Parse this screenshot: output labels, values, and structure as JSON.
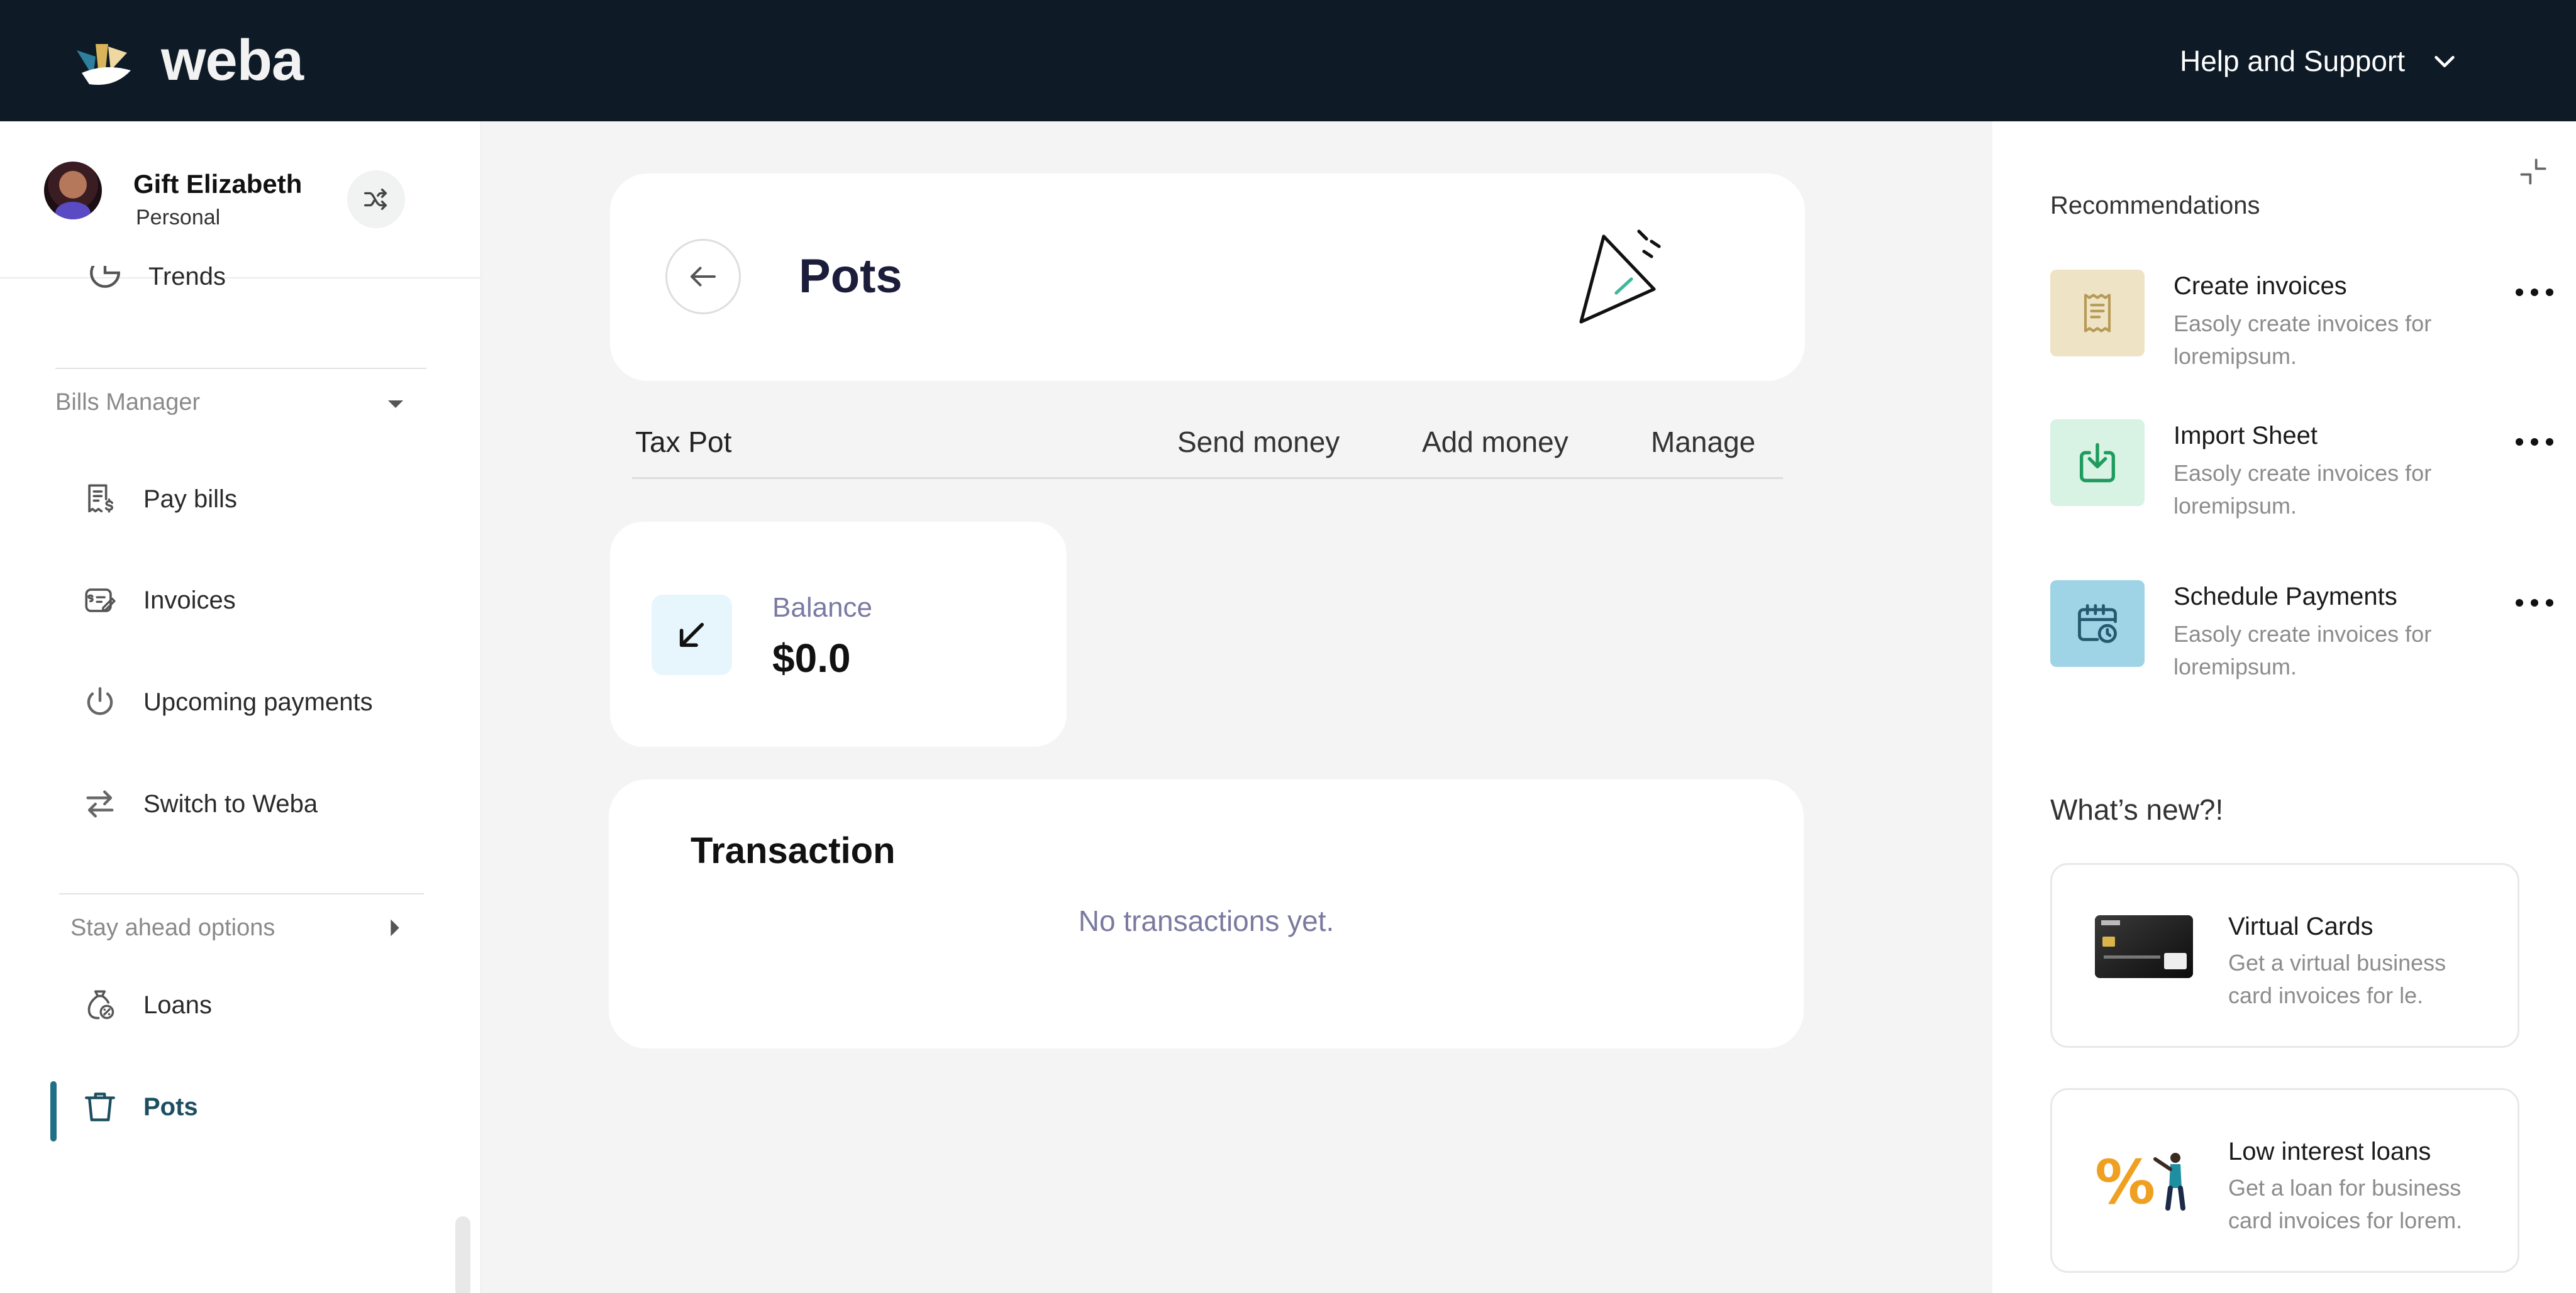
{
  "header": {
    "logo_text": "weba",
    "help_label": "Help and Support"
  },
  "user": {
    "name": "Gift Elizabeth",
    "account_type": "Personal"
  },
  "sidebar": {
    "partial_item": "Trends",
    "sections": [
      {
        "title": "Bills Manager",
        "expanded": true,
        "items": [
          {
            "label": "Pay bills",
            "icon": "receipt-dollar-icon"
          },
          {
            "label": "Invoices",
            "icon": "invoice-edit-icon"
          },
          {
            "label": "Upcoming payments",
            "icon": "power-icon"
          },
          {
            "label": "Switch to Weba",
            "icon": "arrows-swap-icon"
          }
        ]
      },
      {
        "title": "Stay ahead options",
        "expanded": false,
        "items": [
          {
            "label": "Loans",
            "icon": "money-bag-icon"
          },
          {
            "label": "Pots",
            "icon": "pot-icon",
            "active": true
          }
        ]
      }
    ]
  },
  "main": {
    "page_title": "Pots",
    "pot_name": "Tax Pot",
    "actions": [
      "Send money",
      "Add money",
      "Manage"
    ],
    "balance": {
      "label": "Balance",
      "value": "$0.0"
    },
    "transactions": {
      "title": "Transaction",
      "empty_text": "No transactions yet."
    }
  },
  "right_panel": {
    "recommendations_title": "Recommendations",
    "recommendations": [
      {
        "title": "Create invoices",
        "desc": "Easoly create invoices for loremipsum.",
        "icon": "receipt-icon",
        "bg": "#efe3c6"
      },
      {
        "title": "Import Sheet",
        "desc": "Easoly create invoices for loremipsum.",
        "icon": "download-icon",
        "bg": "#d8f2e4"
      },
      {
        "title": "Schedule Payments",
        "desc": "Easoly create invoices for loremipsum.",
        "icon": "calendar-clock-icon",
        "bg": "#9fd3e6"
      }
    ],
    "whats_new_title": "What’s new?!",
    "whats_new": [
      {
        "title": "Virtual Cards",
        "desc": "Get a virtual business card invoices for le."
      },
      {
        "title": "Low interest loans",
        "desc": "Get a loan for  business card invoices for lorem."
      }
    ]
  },
  "colors": {
    "topbar": "#0e1a26",
    "accent": "#1f6f86",
    "muted_text": "#8c8c8c"
  }
}
